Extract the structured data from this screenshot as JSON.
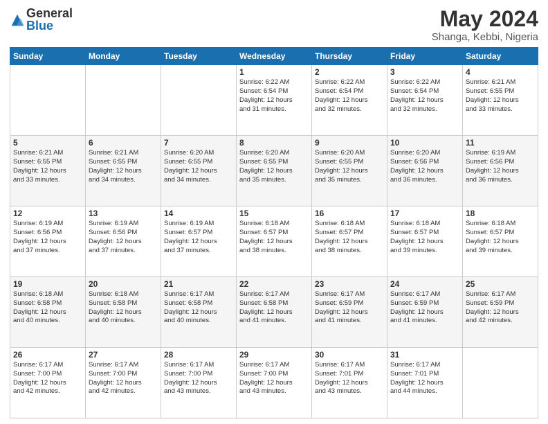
{
  "logo": {
    "general": "General",
    "blue": "Blue"
  },
  "title": "May 2024",
  "subtitle": "Shanga, Kebbi, Nigeria",
  "days": [
    "Sunday",
    "Monday",
    "Tuesday",
    "Wednesday",
    "Thursday",
    "Friday",
    "Saturday"
  ],
  "weeks": [
    [
      {
        "num": "",
        "info": ""
      },
      {
        "num": "",
        "info": ""
      },
      {
        "num": "",
        "info": ""
      },
      {
        "num": "1",
        "info": "Sunrise: 6:22 AM\nSunset: 6:54 PM\nDaylight: 12 hours\nand 31 minutes."
      },
      {
        "num": "2",
        "info": "Sunrise: 6:22 AM\nSunset: 6:54 PM\nDaylight: 12 hours\nand 32 minutes."
      },
      {
        "num": "3",
        "info": "Sunrise: 6:22 AM\nSunset: 6:54 PM\nDaylight: 12 hours\nand 32 minutes."
      },
      {
        "num": "4",
        "info": "Sunrise: 6:21 AM\nSunset: 6:55 PM\nDaylight: 12 hours\nand 33 minutes."
      }
    ],
    [
      {
        "num": "5",
        "info": "Sunrise: 6:21 AM\nSunset: 6:55 PM\nDaylight: 12 hours\nand 33 minutes."
      },
      {
        "num": "6",
        "info": "Sunrise: 6:21 AM\nSunset: 6:55 PM\nDaylight: 12 hours\nand 34 minutes."
      },
      {
        "num": "7",
        "info": "Sunrise: 6:20 AM\nSunset: 6:55 PM\nDaylight: 12 hours\nand 34 minutes."
      },
      {
        "num": "8",
        "info": "Sunrise: 6:20 AM\nSunset: 6:55 PM\nDaylight: 12 hours\nand 35 minutes."
      },
      {
        "num": "9",
        "info": "Sunrise: 6:20 AM\nSunset: 6:55 PM\nDaylight: 12 hours\nand 35 minutes."
      },
      {
        "num": "10",
        "info": "Sunrise: 6:20 AM\nSunset: 6:56 PM\nDaylight: 12 hours\nand 36 minutes."
      },
      {
        "num": "11",
        "info": "Sunrise: 6:19 AM\nSunset: 6:56 PM\nDaylight: 12 hours\nand 36 minutes."
      }
    ],
    [
      {
        "num": "12",
        "info": "Sunrise: 6:19 AM\nSunset: 6:56 PM\nDaylight: 12 hours\nand 37 minutes."
      },
      {
        "num": "13",
        "info": "Sunrise: 6:19 AM\nSunset: 6:56 PM\nDaylight: 12 hours\nand 37 minutes."
      },
      {
        "num": "14",
        "info": "Sunrise: 6:19 AM\nSunset: 6:57 PM\nDaylight: 12 hours\nand 37 minutes."
      },
      {
        "num": "15",
        "info": "Sunrise: 6:18 AM\nSunset: 6:57 PM\nDaylight: 12 hours\nand 38 minutes."
      },
      {
        "num": "16",
        "info": "Sunrise: 6:18 AM\nSunset: 6:57 PM\nDaylight: 12 hours\nand 38 minutes."
      },
      {
        "num": "17",
        "info": "Sunrise: 6:18 AM\nSunset: 6:57 PM\nDaylight: 12 hours\nand 39 minutes."
      },
      {
        "num": "18",
        "info": "Sunrise: 6:18 AM\nSunset: 6:57 PM\nDaylight: 12 hours\nand 39 minutes."
      }
    ],
    [
      {
        "num": "19",
        "info": "Sunrise: 6:18 AM\nSunset: 6:58 PM\nDaylight: 12 hours\nand 40 minutes."
      },
      {
        "num": "20",
        "info": "Sunrise: 6:18 AM\nSunset: 6:58 PM\nDaylight: 12 hours\nand 40 minutes."
      },
      {
        "num": "21",
        "info": "Sunrise: 6:17 AM\nSunset: 6:58 PM\nDaylight: 12 hours\nand 40 minutes."
      },
      {
        "num": "22",
        "info": "Sunrise: 6:17 AM\nSunset: 6:58 PM\nDaylight: 12 hours\nand 41 minutes."
      },
      {
        "num": "23",
        "info": "Sunrise: 6:17 AM\nSunset: 6:59 PM\nDaylight: 12 hours\nand 41 minutes."
      },
      {
        "num": "24",
        "info": "Sunrise: 6:17 AM\nSunset: 6:59 PM\nDaylight: 12 hours\nand 41 minutes."
      },
      {
        "num": "25",
        "info": "Sunrise: 6:17 AM\nSunset: 6:59 PM\nDaylight: 12 hours\nand 42 minutes."
      }
    ],
    [
      {
        "num": "26",
        "info": "Sunrise: 6:17 AM\nSunset: 7:00 PM\nDaylight: 12 hours\nand 42 minutes."
      },
      {
        "num": "27",
        "info": "Sunrise: 6:17 AM\nSunset: 7:00 PM\nDaylight: 12 hours\nand 42 minutes."
      },
      {
        "num": "28",
        "info": "Sunrise: 6:17 AM\nSunset: 7:00 PM\nDaylight: 12 hours\nand 43 minutes."
      },
      {
        "num": "29",
        "info": "Sunrise: 6:17 AM\nSunset: 7:00 PM\nDaylight: 12 hours\nand 43 minutes."
      },
      {
        "num": "30",
        "info": "Sunrise: 6:17 AM\nSunset: 7:01 PM\nDaylight: 12 hours\nand 43 minutes."
      },
      {
        "num": "31",
        "info": "Sunrise: 6:17 AM\nSunset: 7:01 PM\nDaylight: 12 hours\nand 44 minutes."
      },
      {
        "num": "",
        "info": ""
      }
    ]
  ]
}
